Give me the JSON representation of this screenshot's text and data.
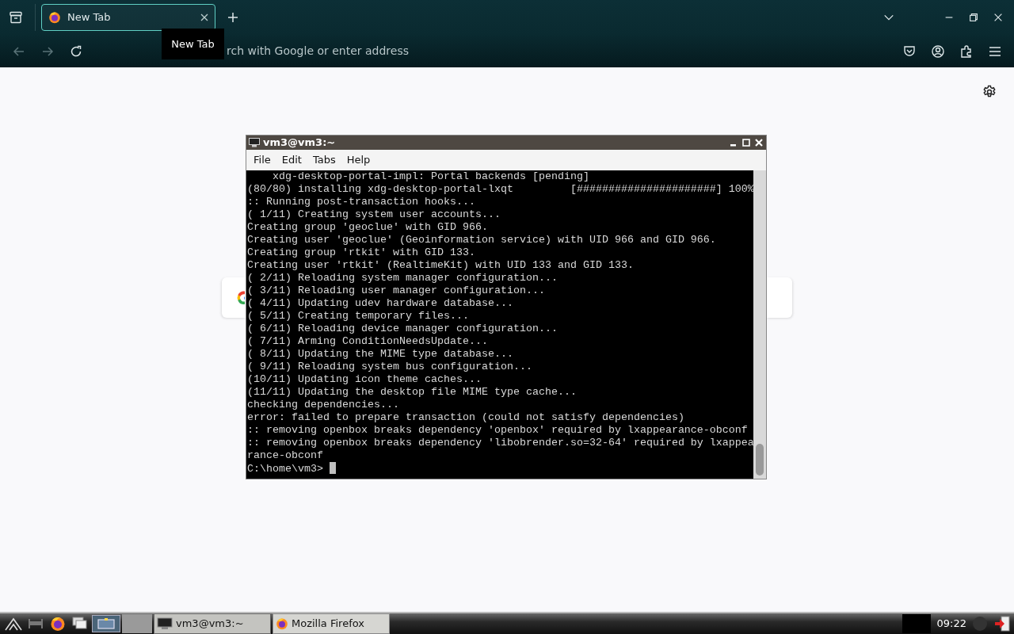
{
  "browser": {
    "tabs": [
      {
        "label": "New Tab",
        "selected": true
      }
    ],
    "tooltip": "New Tab",
    "address_bar": {
      "placeholder": "rch with Google or enter address"
    }
  },
  "terminal": {
    "title": "vm3@vm3:~",
    "menu": [
      "File",
      "Edit",
      "Tabs",
      "Help"
    ],
    "lines": [
      "    xdg-desktop-portal-impl: Portal backends [pending]",
      "(80/80) installing xdg-desktop-portal-lxqt         [######################] 100%",
      ":: Running post-transaction hooks...",
      "( 1/11) Creating system user accounts...",
      "Creating group 'geoclue' with GID 966.",
      "Creating user 'geoclue' (Geoinformation service) with UID 966 and GID 966.",
      "Creating group 'rtkit' with GID 133.",
      "Creating user 'rtkit' (RealtimeKit) with UID 133 and GID 133.",
      "( 2/11) Reloading system manager configuration...",
      "( 3/11) Reloading user manager configuration...",
      "( 4/11) Updating udev hardware database...",
      "( 5/11) Creating temporary files...",
      "( 6/11) Reloading device manager configuration...",
      "( 7/11) Arming ConditionNeedsUpdate...",
      "( 8/11) Updating the MIME type database...",
      "( 9/11) Reloading system bus configuration...",
      "(10/11) Updating icon theme caches...",
      "(11/11) Updating the desktop file MIME type cache...",
      "checking dependencies...",
      "error: failed to prepare transaction (could not satisfy dependencies)",
      ":: removing openbox breaks dependency 'openbox' required by lxappearance-obconf",
      ":: removing openbox breaks dependency 'libobrender.so=32-64' required by lxappea",
      "rance-obconf"
    ],
    "prompt": "C:\\home\\vm3>"
  },
  "taskbar": {
    "tasks": [
      {
        "label": "vm3@vm3:~",
        "selected": true
      },
      {
        "label": "Mozilla Firefox",
        "selected": false
      }
    ],
    "clock": "09:22"
  }
}
